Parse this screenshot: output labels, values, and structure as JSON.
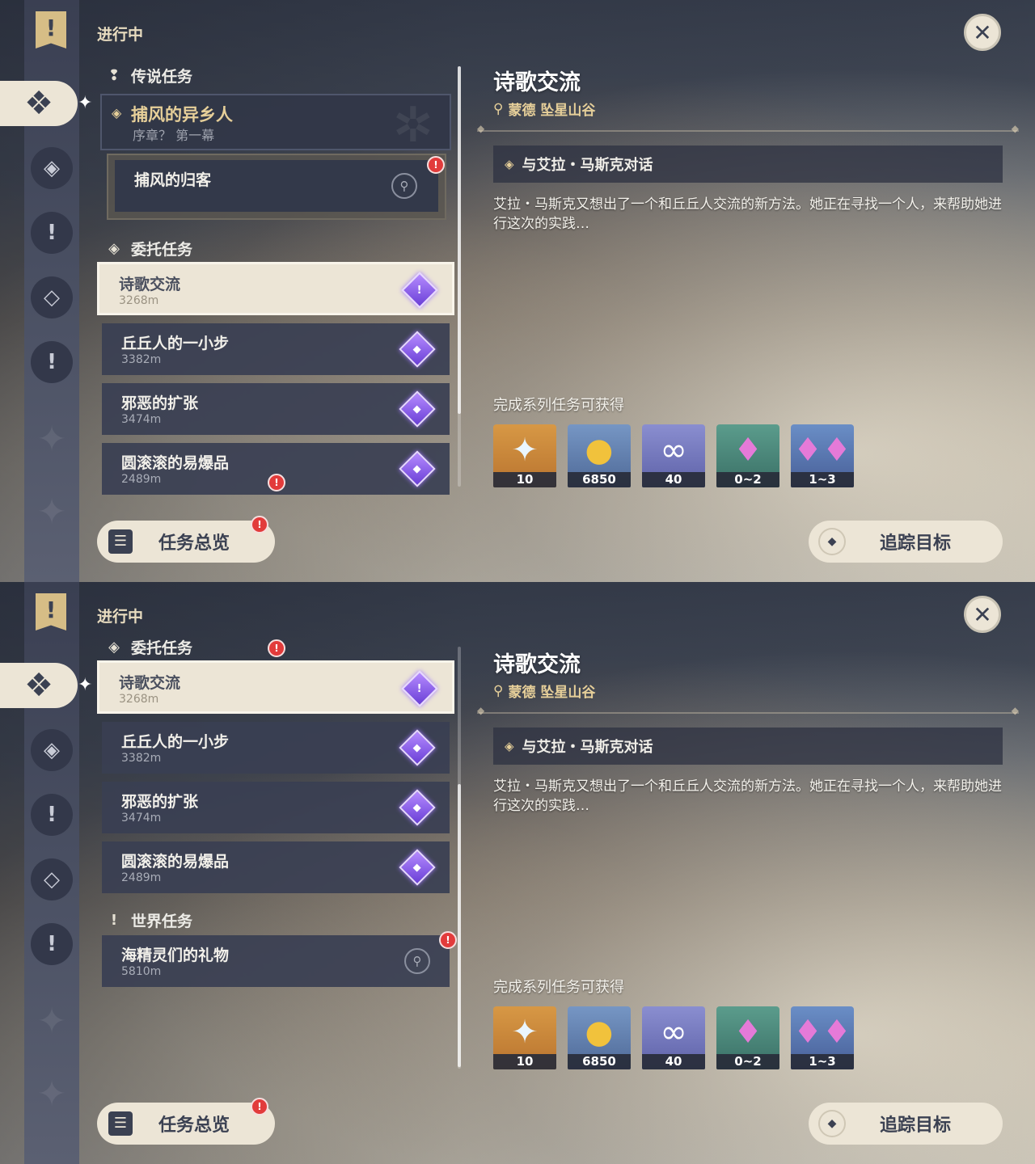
{
  "common": {
    "section_title": "进行中",
    "overview_label": "任务总览",
    "track_label": "追踪目标",
    "close_glyph": "✕",
    "detail": {
      "title": "诗歌交流",
      "location": "蒙德 坠星山谷",
      "objective": "与艾拉・马斯克对话",
      "description": "艾拉・马斯克又想出了一个和丘丘人交流的新方法。她正在寻找一个人，来帮助她进行这次的实践…",
      "rewards_title": "完成系列任务可获得",
      "rewards": [
        {
          "icon": "primogem-icon",
          "qty": "10"
        },
        {
          "icon": "mora-icon",
          "qty": "6850"
        },
        {
          "icon": "adventure-exp-icon",
          "qty": "40"
        },
        {
          "icon": "crystal-green-icon",
          "qty": "0~2"
        },
        {
          "icon": "crystal-blue-icon",
          "qty": "1~3"
        }
      ]
    }
  },
  "panel1": {
    "legend_category": "传说任务",
    "legend_quest": {
      "name": "捕风的异乡人",
      "subtitle": "序章？ 第一幕"
    },
    "legend_subquest": {
      "name": "捕风的归客"
    },
    "commission_category": "委托任务",
    "quests": [
      {
        "name": "诗歌交流",
        "distance": "3268m"
      },
      {
        "name": "丘丘人的一小步",
        "distance": "3382m"
      },
      {
        "name": "邪恶的扩张",
        "distance": "3474m"
      },
      {
        "name": "圆滚滚的易爆品",
        "distance": "2489m"
      }
    ]
  },
  "panel2": {
    "commission_category": "委托任务",
    "quests": [
      {
        "name": "诗歌交流",
        "distance": "3268m"
      },
      {
        "name": "丘丘人的一小步",
        "distance": "3382m"
      },
      {
        "name": "邪恶的扩张",
        "distance": "3474m"
      },
      {
        "name": "圆滚滚的易爆品",
        "distance": "2489m"
      }
    ],
    "world_category": "世界任务",
    "world_quest": {
      "name": "海精灵们的礼物",
      "distance": "5810m"
    }
  },
  "colors": {
    "accent_gold": "#e6cf99",
    "card_dark": "#3a3f52",
    "card_selected": "#ece5d6",
    "badge_red": "#e23b3b"
  }
}
